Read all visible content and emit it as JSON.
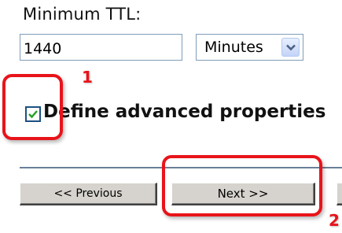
{
  "ttl": {
    "label": "Minimum TTL:",
    "value": "1440",
    "unit_selected": "Minutes"
  },
  "advanced": {
    "label": "Define advanced properties",
    "checked": true
  },
  "nav": {
    "previous_label": "<< Previous",
    "next_label": "Next >>"
  },
  "annotations": {
    "step1": "1",
    "step2": "2",
    "color": "#e8141a"
  },
  "icons": {
    "dropdown": "chevron-down-icon",
    "check": "checkmark-icon"
  }
}
